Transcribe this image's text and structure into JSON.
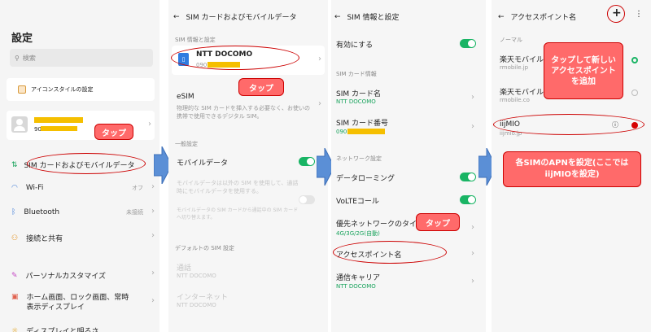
{
  "screen1": {
    "title": "設定",
    "search_placeholder": "検索",
    "icon_style": "アイコンスタイルの設定",
    "account_number_prefix": "90",
    "sim_mobile": "SIM カードおよびモバイルデータ",
    "wifi": "Wi-Fi",
    "wifi_status": "オフ",
    "bluetooth": "Bluetooth",
    "bluetooth_status": "未接続",
    "connection_share": "接続と共有",
    "personal_customize": "パーソナルカスタマイズ",
    "home_screen": "ホーム画面、ロック画面、常時表示ディスプレイ",
    "display_partial": "ディスプレイと明るさ",
    "tap_callout": "タップ"
  },
  "screen2": {
    "header": "SIM カードおよびモバイルデータ",
    "sec_sim_info": "SIM 情報と設定",
    "carrier": "NTT DOCOMO",
    "carrier_number_prefix": "090",
    "esim": "eSIM",
    "esim_desc": "物理的な SIM カードを挿入する必要なく、お使いの携帯で使用できるデジタル SIM。",
    "sec_general": "一般設定",
    "mobile_data": "モバイルデータ",
    "mobile_data_desc": "モバイルデータは以外の SIM を使用して、通話時にモバイルデータを使用する。",
    "mobile_data_desc2": "モバイルデータの SIM カードから通話中の SIM カードへ切り替えます。",
    "sec_default_sim": "デフォルトの SIM 設定",
    "call": "通話",
    "call_value": "NTT DOCOMO",
    "internet": "インターネット",
    "internet_value": "NTT DOCOMO",
    "tap_callout": "タップ"
  },
  "screen3": {
    "header": "SIM 情報と設定",
    "enable": "有効にする",
    "sec_sim_info": "SIM カード情報",
    "sim_name": "SIM カード名",
    "sim_name_value": "NTT DOCOMO",
    "sim_number": "SIM カード番号",
    "sim_number_prefix": "090",
    "sec_network": "ネットワーク設定",
    "data_roaming": "データローミング",
    "volte": "VoLTEコール",
    "preferred_network": "優先ネットワークのタイプ",
    "preferred_network_value": "4G/3G/2G(自動)",
    "apn": "アクセスポイント名",
    "carrier_label": "通信キャリア",
    "carrier_value": "NTT DOCOMO",
    "tap_callout": "タップ"
  },
  "screen4": {
    "header": "アクセスポイント名",
    "add_symbol": "+",
    "more_symbol": "⋮",
    "sec_normal": "ノーマル",
    "apn1_name": "楽天モバイル",
    "apn1_sub": "rmobile.jp",
    "apn2_name": "楽天モバイル",
    "apn2_sub": "rmobile.co",
    "apn3_name": "iijMIO",
    "apn3_sub": "iijmio.jp",
    "callout_add": "タップして新しいアクセスポイントを追加",
    "callout_apn": "各SIMのAPNを設定(ここではiijMIOを設定)"
  },
  "colors": {
    "accent_green": "#19b464",
    "callout_red": "#ff6a6a",
    "arrow_blue": "#5b8fd6"
  }
}
